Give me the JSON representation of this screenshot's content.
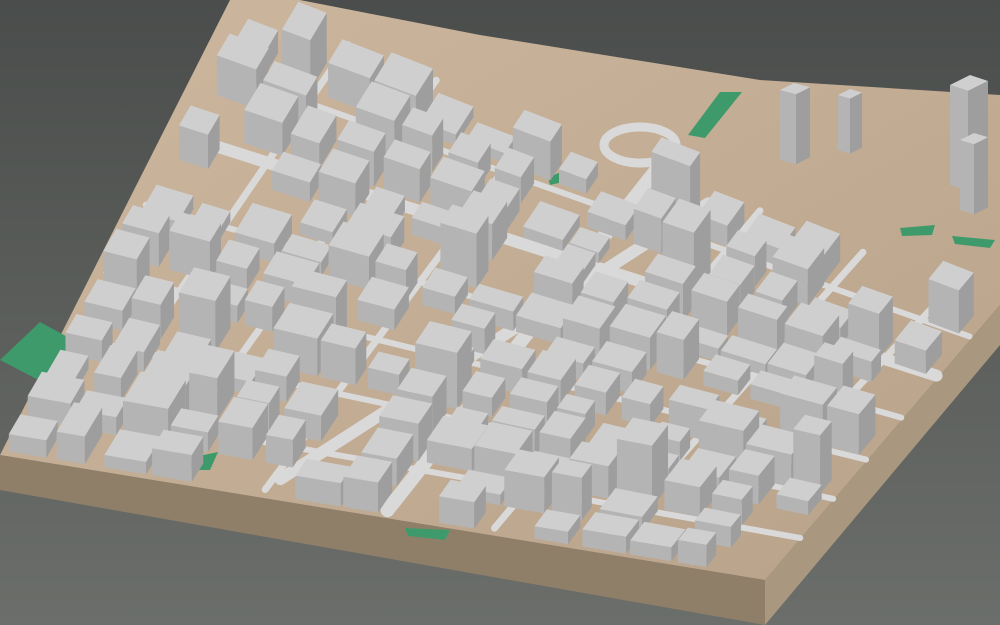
{
  "scene": {
    "subject": "isometric-3d-city-block-model",
    "colors": {
      "background_top": "#4a4d4b",
      "background_bottom": "#6b6e6a",
      "terrain": "#cdb79e",
      "terrain_shade": "#b8a28a",
      "base_side": "#a9987f",
      "base_side_dark": "#8f7f69",
      "road": "#d9d9d9",
      "building_top": "#cfcfcf",
      "building_left": "#b4b4b4",
      "building_right": "#9e9e9e",
      "park": "#3f9a6b"
    },
    "elements": [
      "terrain-base",
      "road-network",
      "roundabout",
      "buildings",
      "parks",
      "tower-cluster"
    ]
  }
}
